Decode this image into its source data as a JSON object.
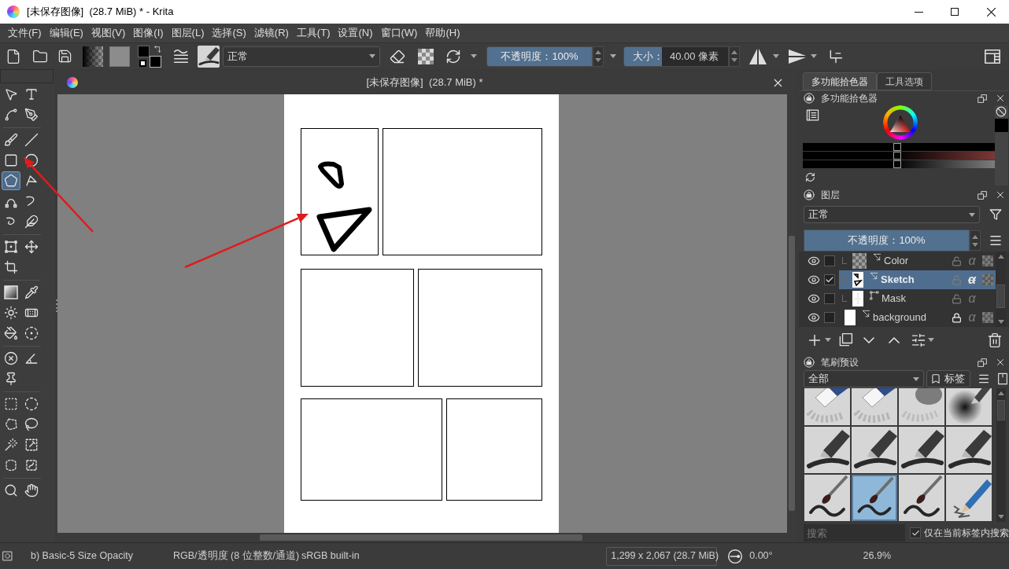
{
  "window": {
    "title": "[未保存图像]  (28.7 MiB) * - Krita"
  },
  "menu": [
    "文件(F)",
    "编辑(E)",
    "视图(V)",
    "图像(I)",
    "图层(L)",
    "选择(S)",
    "滤镜(R)",
    "工具(T)",
    "设置(N)",
    "窗口(W)",
    "帮助(H)"
  ],
  "toolbar": {
    "blend_mode": "正常",
    "opacity": {
      "text": "不透明度：100%",
      "level": 1
    },
    "size": {
      "label": "大小：",
      "value": "40.00 像素",
      "level": 0.36
    }
  },
  "tool_groups": [
    {
      "tools": [
        {
          "kind": "select",
          "selected": false
        },
        {
          "kind": "text",
          "selected": false
        },
        {
          "kind": "edit_shapes",
          "selected": false
        },
        {
          "kind": "calligraphy",
          "selected": false
        }
      ]
    },
    {
      "tools": [
        {
          "kind": "freehand_brush",
          "selected": false
        },
        {
          "kind": "line",
          "selected": false
        },
        {
          "kind": "rectangle",
          "selected": false
        },
        {
          "kind": "ellipse",
          "selected": false
        },
        {
          "kind": "polygon",
          "selected": true
        },
        {
          "kind": "polyline",
          "selected": false
        },
        {
          "kind": "bezier",
          "selected": false
        },
        {
          "kind": "freehand_path",
          "selected": false
        },
        {
          "kind": "dynamic_brush",
          "selected": false
        },
        {
          "kind": "multibrush",
          "selected": false
        }
      ]
    },
    {
      "tools": [
        {
          "kind": "transform",
          "selected": false
        },
        {
          "kind": "move",
          "selected": false
        },
        {
          "kind": "crop",
          "selected": false
        }
      ]
    },
    {
      "tools": [
        {
          "kind": "gradient",
          "selected": false
        },
        {
          "kind": "color_sampler",
          "selected": false
        },
        {
          "kind": "colorize_mask",
          "selected": false
        },
        {
          "kind": "smart_patch",
          "selected": false
        },
        {
          "kind": "fill",
          "selected": false
        },
        {
          "kind": "enclose_fill",
          "selected": false
        }
      ]
    },
    {
      "tools": [
        {
          "kind": "assistant",
          "selected": false
        },
        {
          "kind": "measure",
          "selected": false
        },
        {
          "kind": "reference",
          "selected": false
        }
      ]
    },
    {
      "tools": [
        {
          "kind": "rect_select",
          "selected": false
        },
        {
          "kind": "ellipse_select",
          "selected": false
        },
        {
          "kind": "polygon_select",
          "selected": false
        },
        {
          "kind": "freehand_select",
          "selected": false
        },
        {
          "kind": "contiguous_select",
          "selected": false
        },
        {
          "kind": "similar_select",
          "selected": false
        },
        {
          "kind": "bezier_select",
          "selected": false
        },
        {
          "kind": "magnetic_select",
          "selected": false
        }
      ]
    },
    {
      "tools": [
        {
          "kind": "zoom",
          "selected": false
        },
        {
          "kind": "pan",
          "selected": false
        }
      ]
    }
  ],
  "document": {
    "title": "[未保存图像]  (28.7 MiB) *"
  },
  "dock_tabs": [
    {
      "label": "多功能拾色器",
      "selected": true
    },
    {
      "label": "工具选项",
      "selected": false
    }
  ],
  "color_selector": {
    "title": "多功能拾色器",
    "sliders": [
      {
        "level": 0.49
      },
      {
        "level": 0.49
      },
      {
        "level": 0.49
      }
    ]
  },
  "layers": {
    "title": "图层",
    "blend_mode": "正常",
    "opacity": {
      "text": "不透明度：100%",
      "level": 1
    },
    "rows": [
      {
        "children": [
          {
            "name": "Color",
            "selected": false,
            "visible": true,
            "checked": false,
            "kind": "empty_paint",
            "locked": false,
            "alpha": "α",
            "alpha_locked": false,
            "inherit_alpha": true
          },
          {
            "name": "Sketch",
            "selected": true,
            "visible": true,
            "checked": true,
            "kind": "paint",
            "locked": false,
            "alpha": "α",
            "alpha_locked": true,
            "inherit_alpha": true
          },
          {
            "name": "Mask",
            "selected": false,
            "visible": true,
            "checked": false,
            "kind": "vector",
            "locked": false,
            "alpha": "α",
            "alpha_locked": false,
            "inherit_alpha": false
          }
        ]
      },
      {
        "name": "background",
        "selected": false,
        "visible": true,
        "checked": false,
        "kind": "background",
        "locked": true,
        "alpha": "α",
        "alpha_locked": false,
        "inherit_alpha": true
      }
    ]
  },
  "brush_presets": {
    "title": "笔刷预设",
    "filter": "全部",
    "tag_button": "标签",
    "presets": [
      {
        "kind": "eraser",
        "selected": false
      },
      {
        "kind": "eraser",
        "selected": false
      },
      {
        "kind": "blender",
        "selected": false
      },
      {
        "kind": "airbrush",
        "selected": false
      },
      {
        "kind": "pen",
        "selected": false
      },
      {
        "kind": "pen",
        "selected": false
      },
      {
        "kind": "pen",
        "selected": false
      },
      {
        "kind": "pen",
        "selected": false
      },
      {
        "kind": "brush",
        "selected": false
      },
      {
        "kind": "brush",
        "selected": true
      },
      {
        "kind": "brush",
        "selected": false
      },
      {
        "kind": "pencil",
        "selected": false
      }
    ],
    "search": {
      "placeholder": "搜索"
    },
    "search_in_tag": {
      "label": "仅在当前标签内搜索",
      "checked": true
    }
  },
  "status_bar": {
    "brush": "b) Basic-5 Size Opacity",
    "color_space": "RGB/透明度 (8 位整数/通道)",
    "profile": "sRGB built-in",
    "dimensions": "1,299 x 2,067 (28.7 MiB)",
    "rotation": "0.00°",
    "zoom": "26.9%"
  }
}
